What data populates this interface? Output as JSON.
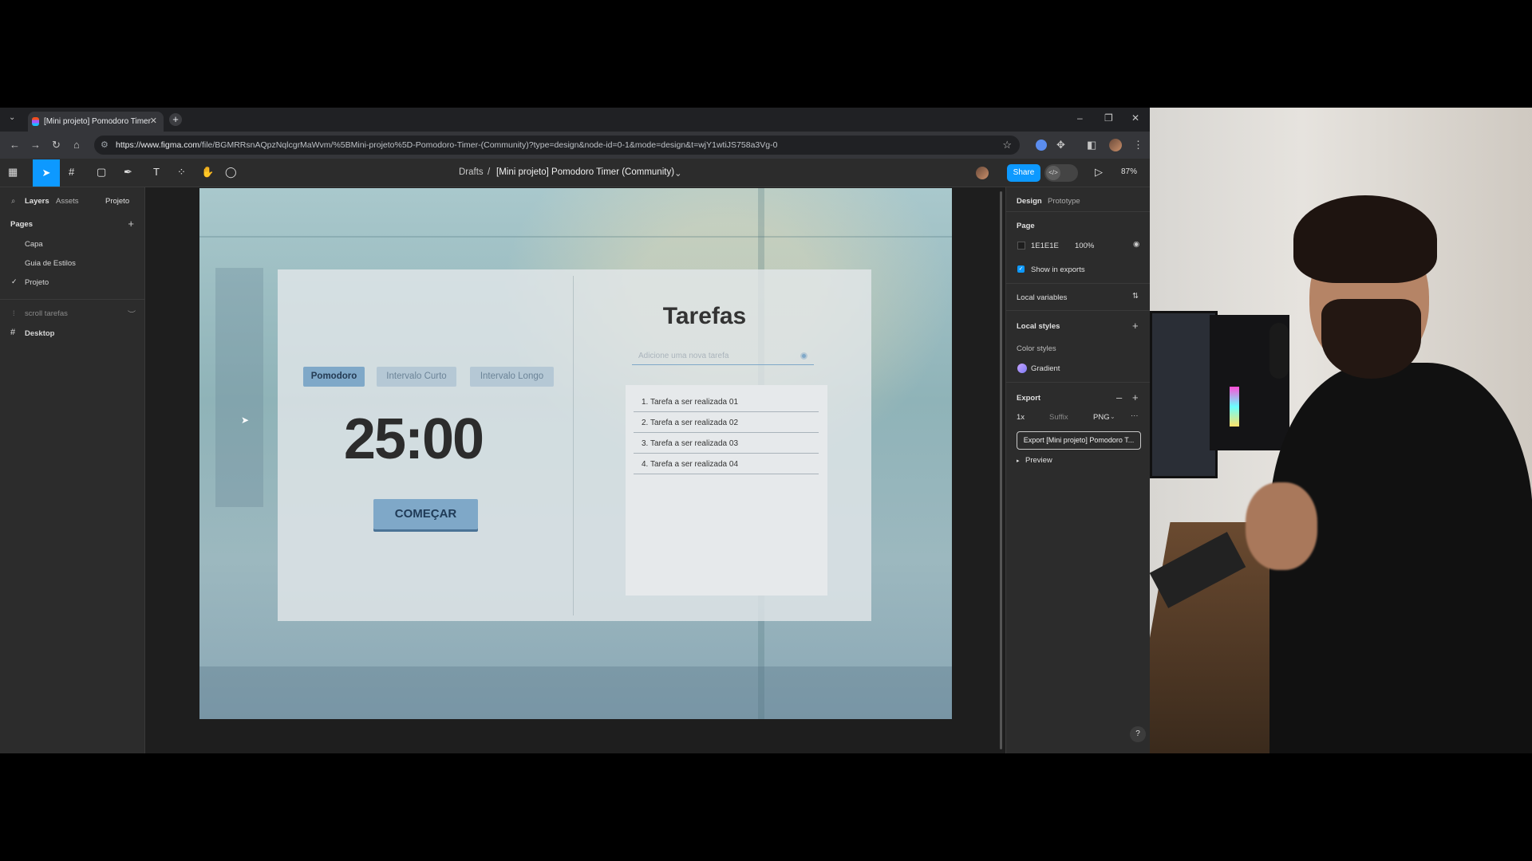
{
  "browser": {
    "tab_title": "[Mini projeto] Pomodoro Timer",
    "url_host": "https://www.figma.com",
    "url_path": "/file/BGMRRsnAQpzNqlcgrMaWvm/%5BMini-projeto%5D-Pomodoro-Timer-(Community)?type=design&node-id=0-1&mode=design&t=wjY1wtiJS758a3Vg-0"
  },
  "figma": {
    "breadcrumb_drafts": "Drafts",
    "breadcrumb_sep": "/",
    "file_title": "[Mini projeto] Pomodoro Timer (Community)",
    "share_label": "Share",
    "zoom": "87%"
  },
  "left_panel": {
    "tab_layers": "Layers",
    "tab_assets": "Assets",
    "page_selector": "Projeto",
    "pages_heading": "Pages",
    "pages": [
      "Capa",
      "Guia de Estilos",
      "Projeto"
    ],
    "layers": [
      "scroll tarefas",
      "Desktop"
    ]
  },
  "design": {
    "modes": [
      "Pomodoro",
      "Intervalo Curto",
      "Intervalo Longo"
    ],
    "timer": "25:00",
    "start_label": "COMEÇAR",
    "tasks_title": "Tarefas",
    "task_placeholder": "Adicione uma nova tarefa",
    "tasks": [
      "1. Tarefa a ser realizada 01",
      "2. Tarefa a ser realizada 02",
      "3. Tarefa a ser realizada 03",
      "4. Tarefa a ser realizada 04"
    ],
    "accent": "#7fa8c8"
  },
  "right_panel": {
    "tab_design": "Design",
    "tab_prototype": "Prototype",
    "page_heading": "Page",
    "bg_color": "1E1E1E",
    "bg_opacity": "100%",
    "show_in_exports": "Show in exports",
    "local_variables": "Local variables",
    "local_styles": "Local styles",
    "color_styles": "Color styles",
    "gradient_label": "Gradient",
    "export_heading": "Export",
    "export_scale": "1x",
    "export_suffix": "Suffix",
    "export_format": "PNG",
    "export_button": "Export [Mini projeto] Pomodoro T...",
    "preview_label": "Preview",
    "help": "?"
  }
}
